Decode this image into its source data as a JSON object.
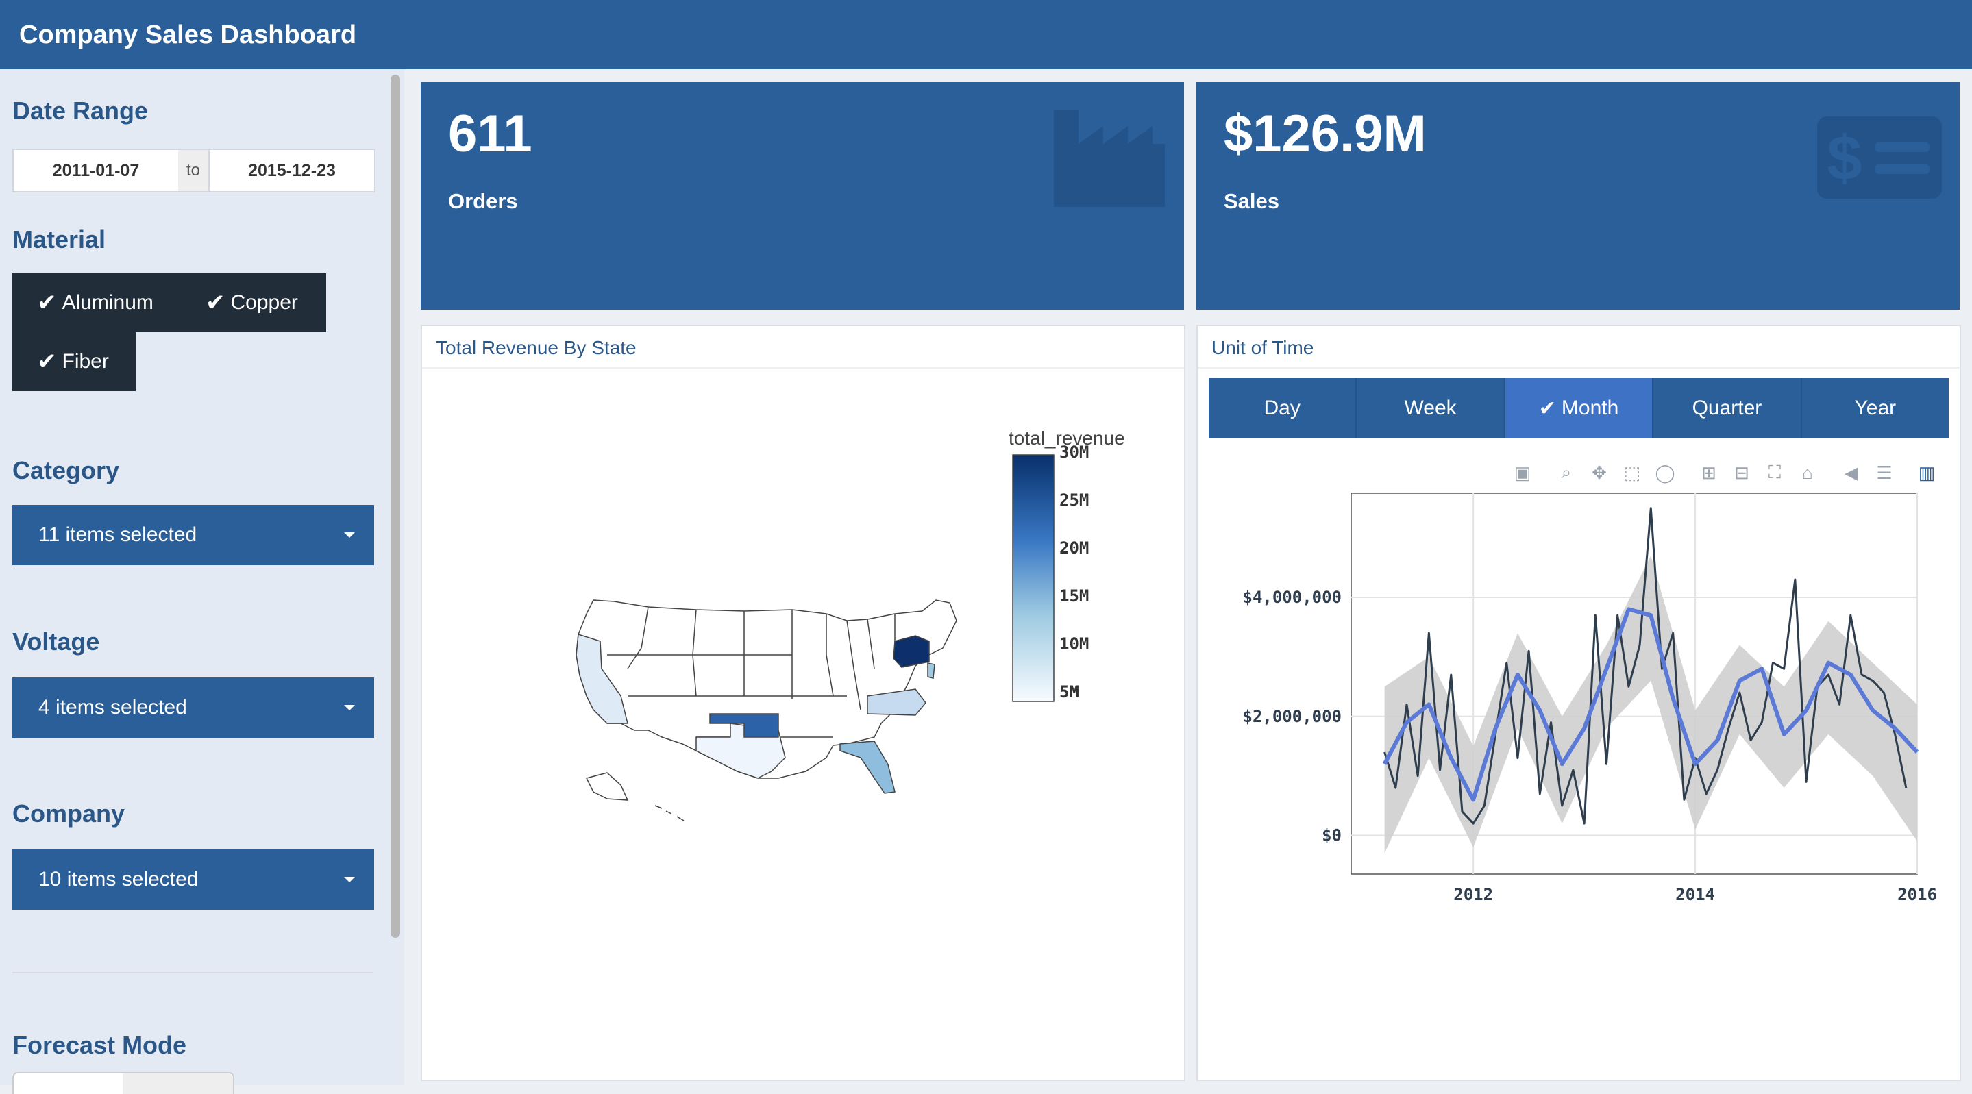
{
  "header": {
    "title": "Company Sales Dashboard"
  },
  "sidebar": {
    "date_range": {
      "label": "Date Range",
      "start": "2011-01-07",
      "to": "to",
      "end": "2015-12-23"
    },
    "material": {
      "label": "Material",
      "options": [
        "Aluminum",
        "Copper",
        "Fiber"
      ]
    },
    "category": {
      "label": "Category",
      "value": "11 items selected"
    },
    "voltage": {
      "label": "Voltage",
      "value": "4 items selected"
    },
    "company": {
      "label": "Company",
      "value": "10 items selected"
    },
    "forecast": {
      "label": "Forecast Mode"
    }
  },
  "kpis": {
    "orders": {
      "value": "611",
      "label": "Orders"
    },
    "sales": {
      "value": "$126.9M",
      "label": "Sales"
    }
  },
  "map_panel": {
    "title": "Total Revenue By State",
    "legend_title": "total_revenue",
    "legend_ticks": [
      "30M",
      "25M",
      "20M",
      "15M",
      "10M",
      "5M"
    ],
    "colors": {
      "low": "#f7fbff",
      "high": "#08306b"
    }
  },
  "time_panel": {
    "title": "Unit of Time",
    "tabs": [
      "Day",
      "Week",
      "Month",
      "Quarter",
      "Year"
    ],
    "active_tab": "Month",
    "modebar_icons": [
      "camera-icon",
      "zoom-icon",
      "pan-icon",
      "box-select-icon",
      "lasso-icon",
      "zoom-in-icon",
      "zoom-out-icon",
      "autoscale-icon",
      "home-icon",
      "spike-icon",
      "compare-icon",
      "plotly-logo-icon"
    ]
  },
  "chart_data": {
    "type": "line",
    "x_ticks": [
      "2012",
      "2014",
      "2016"
    ],
    "y_ticks": [
      "$0",
      "$2,000,000",
      "$4,000,000"
    ],
    "xlim": [
      2010.9,
      2016.0
    ],
    "ylim": [
      -650000,
      5750000
    ],
    "series": [
      {
        "color": "#2f3e4e",
        "x": [
          2011.2,
          2011.3,
          2011.4,
          2011.5,
          2011.6,
          2011.7,
          2011.8,
          2011.9,
          2012.0,
          2012.1,
          2012.2,
          2012.3,
          2012.4,
          2012.5,
          2012.6,
          2012.7,
          2012.8,
          2012.9,
          2013.0,
          2013.1,
          2013.2,
          2013.3,
          2013.4,
          2013.5,
          2013.6,
          2013.7,
          2013.8,
          2013.9,
          2014.0,
          2014.1,
          2014.2,
          2014.3,
          2014.4,
          2014.5,
          2014.6,
          2014.7,
          2014.8,
          2014.9,
          2015.0,
          2015.1,
          2015.2,
          2015.3,
          2015.4,
          2015.5,
          2015.6,
          2015.7,
          2015.8,
          2015.9
        ],
        "values": [
          1400000,
          800000,
          2200000,
          1000000,
          3400000,
          1100000,
          2700000,
          400000,
          200000,
          500000,
          1700000,
          2900000,
          1300000,
          3100000,
          700000,
          1900000,
          500000,
          1100000,
          200000,
          3700000,
          1200000,
          3700000,
          2500000,
          3200000,
          5500000,
          2800000,
          3400000,
          600000,
          1300000,
          700000,
          1100000,
          1800000,
          2400000,
          1600000,
          1900000,
          2900000,
          2800000,
          4300000,
          900000,
          2500000,
          2700000,
          2200000,
          3700000,
          2700000,
          2600000,
          2400000,
          1700000,
          800000
        ]
      },
      {
        "color": "#5b79d6",
        "x": [
          2011.2,
          2011.4,
          2011.6,
          2011.8,
          2012.0,
          2012.2,
          2012.4,
          2012.6,
          2012.8,
          2013.0,
          2013.2,
          2013.4,
          2013.6,
          2013.8,
          2014.0,
          2014.2,
          2014.4,
          2014.6,
          2014.8,
          2015.0,
          2015.2,
          2015.4,
          2015.6,
          2015.8,
          2016.0
        ],
        "values": [
          1200000,
          1900000,
          2200000,
          1300000,
          600000,
          1800000,
          2700000,
          2100000,
          1200000,
          1800000,
          2800000,
          3800000,
          3700000,
          2300000,
          1200000,
          1600000,
          2600000,
          2800000,
          1700000,
          2100000,
          2900000,
          2700000,
          2100000,
          1800000,
          1400000
        ]
      }
    ],
    "band": {
      "x": [
        2011.2,
        2011.6,
        2012.0,
        2012.4,
        2012.8,
        2013.2,
        2013.6,
        2014.0,
        2014.4,
        2014.8,
        2015.2,
        2015.6,
        2016.0
      ],
      "upper": [
        2500000,
        3000000,
        1500000,
        3400000,
        2000000,
        3200000,
        4700000,
        2100000,
        3200000,
        2500000,
        3600000,
        2900000,
        2200000
      ],
      "lower": [
        -300000,
        1300000,
        -200000,
        1800000,
        200000,
        1800000,
        2600000,
        100000,
        1700000,
        800000,
        1700000,
        1000000,
        -100000
      ]
    }
  }
}
